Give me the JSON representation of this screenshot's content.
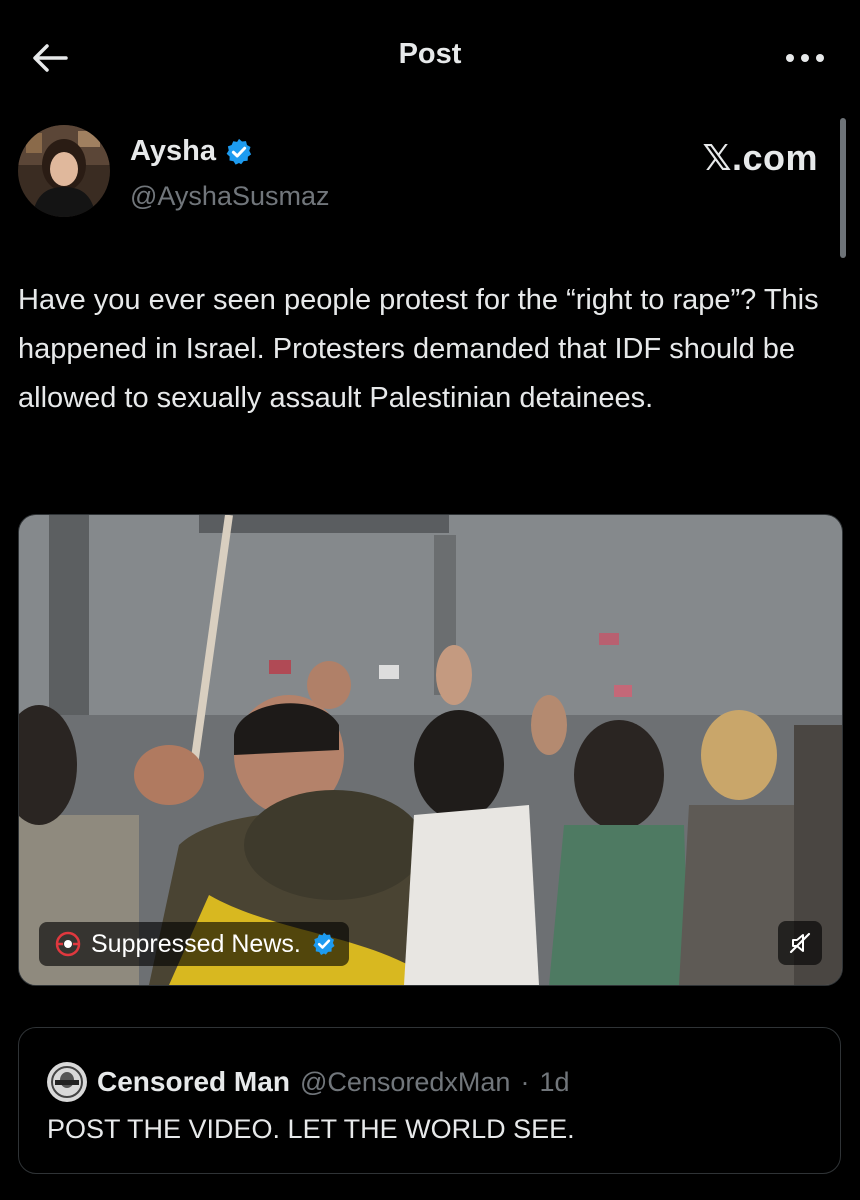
{
  "header": {
    "title": "Post",
    "back_icon": "arrow-left-icon",
    "more_icon": "more-horizontal-icon"
  },
  "post": {
    "author_name": "Aysha",
    "author_handle": "@AyshaSusmaz",
    "verified_icon": "verified-badge-icon",
    "site_logo": "𝕏.com",
    "text": "Have you ever seen people protest for the “right to rape”? This happened in Israel. Protesters demanded that IDF should be allowed to sexually assault Palestinian detainees.",
    "media": {
      "watermark_text": "Suppressed News.",
      "watermark_verified_icon": "verified-badge-icon",
      "mute_icon": "speaker-muted-icon"
    }
  },
  "quoted_post": {
    "author_name": "Censored Man",
    "author_handle": "@CensoredxMan",
    "separator": "·",
    "time": "1d",
    "text": "POST THE VIDEO. LET THE WORLD SEE."
  },
  "colors": {
    "background": "#000000",
    "text": "#e7e9ea",
    "muted": "#71767b",
    "verified": "#1d9bf0",
    "border": "#2f3336"
  }
}
